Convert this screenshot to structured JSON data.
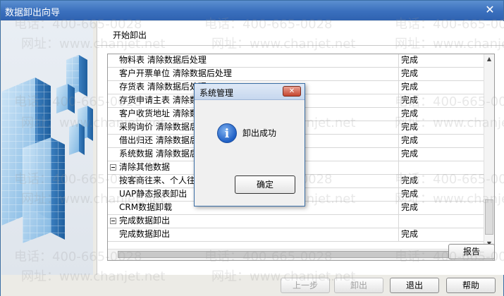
{
  "window": {
    "title": "数据卸出向导",
    "close_glyph": "✕"
  },
  "main": {
    "section_title": "开始卸出",
    "rows": [
      {
        "type": "item",
        "label": "物料表 清除数据后处理",
        "status": "完成"
      },
      {
        "type": "item",
        "label": "客户开票单位 清除数据后处理",
        "status": "完成"
      },
      {
        "type": "item",
        "label": "存货表 清除数据后处理",
        "status": "完成"
      },
      {
        "type": "item",
        "label": "存货申请主表 清除数据后处理",
        "status": "完成"
      },
      {
        "type": "item",
        "label": "客户收货地址 清除数据后处理",
        "status": "完成"
      },
      {
        "type": "item",
        "label": "采购询价 清除数据后处理",
        "status": "完成"
      },
      {
        "type": "item",
        "label": "借出归还 清除数据后处理",
        "status": "完成"
      },
      {
        "type": "item",
        "label": "系统数据 清除数据后处理",
        "status": "完成"
      },
      {
        "type": "group",
        "label": "清除其他数据",
        "status": ""
      },
      {
        "type": "item",
        "label": "按客商往来、个人往来清理数据",
        "status": "完成"
      },
      {
        "type": "item",
        "label": "UAP静态报表卸出",
        "status": "完成"
      },
      {
        "type": "item",
        "label": "CRM数据卸载",
        "status": "完成"
      },
      {
        "type": "group",
        "label": "完成数据卸出",
        "status": ""
      },
      {
        "type": "item",
        "label": "完成数据卸出",
        "status": "完成"
      }
    ],
    "report_button": "报告"
  },
  "buttons": {
    "prev": "上一步",
    "unload": "卸出",
    "exit": "退出",
    "help": "帮助"
  },
  "dialog": {
    "title": "系统管理",
    "close_glyph": "✕",
    "icon": "info-icon",
    "icon_glyph": "i",
    "message": "卸出成功",
    "ok": "确定"
  },
  "watermarks": {
    "phone": "电话：400-665-0028",
    "web": "网址：www.chanjet.net"
  },
  "colors": {
    "titlebar": "#3a6fbd",
    "dialog_close": "#c6452f",
    "info_icon": "#1f5fc4"
  }
}
